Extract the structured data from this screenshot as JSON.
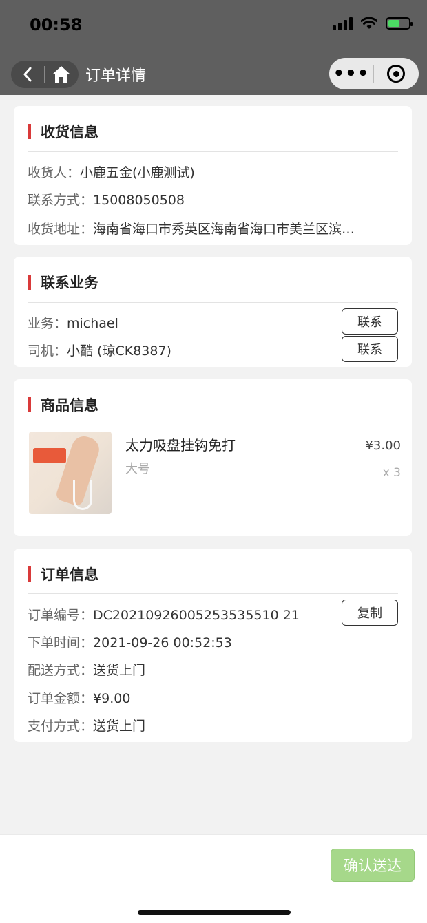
{
  "status_bar": {
    "time": "00:58"
  },
  "nav": {
    "title": "订单详情"
  },
  "receiver": {
    "title": "收货信息",
    "name_label": "收货人：",
    "name_value": "小鹿五金(小鹿测试)",
    "phone_label": "联系方式：",
    "phone_value": "15008050508",
    "address_label": "收货地址：",
    "address_value": "海南省海口市秀英区海南省海口市美兰区滨…"
  },
  "contact": {
    "title": "联系业务",
    "sales_label": "业务：",
    "sales_value": "michael",
    "driver_label": "司机：",
    "driver_value": "小酷 (琼CK8387)",
    "contact_button": "联系"
  },
  "product": {
    "title": "商品信息",
    "name": "太力吸盘挂钩免打",
    "spec": "大号",
    "price": "¥3.00",
    "qty": "x 3"
  },
  "order": {
    "title": "订单信息",
    "number_label": "订单编号：",
    "number_value": "DC20210926005253535510 21",
    "copy_button": "复制",
    "time_label": "下单时间：",
    "time_value": "2021-09-26 00:52:53",
    "delivery_label": "配送方式：",
    "delivery_value": "送货上门",
    "amount_label": "订单金额：",
    "amount_value": "¥9.00",
    "payment_label": "支付方式：",
    "payment_value": "送货上门"
  },
  "footer": {
    "confirm_button": "确认送达"
  },
  "colors": {
    "accent_red": "#d93a3a",
    "confirm_green": "#a6d88a",
    "topbar": "#5f5f5f"
  }
}
